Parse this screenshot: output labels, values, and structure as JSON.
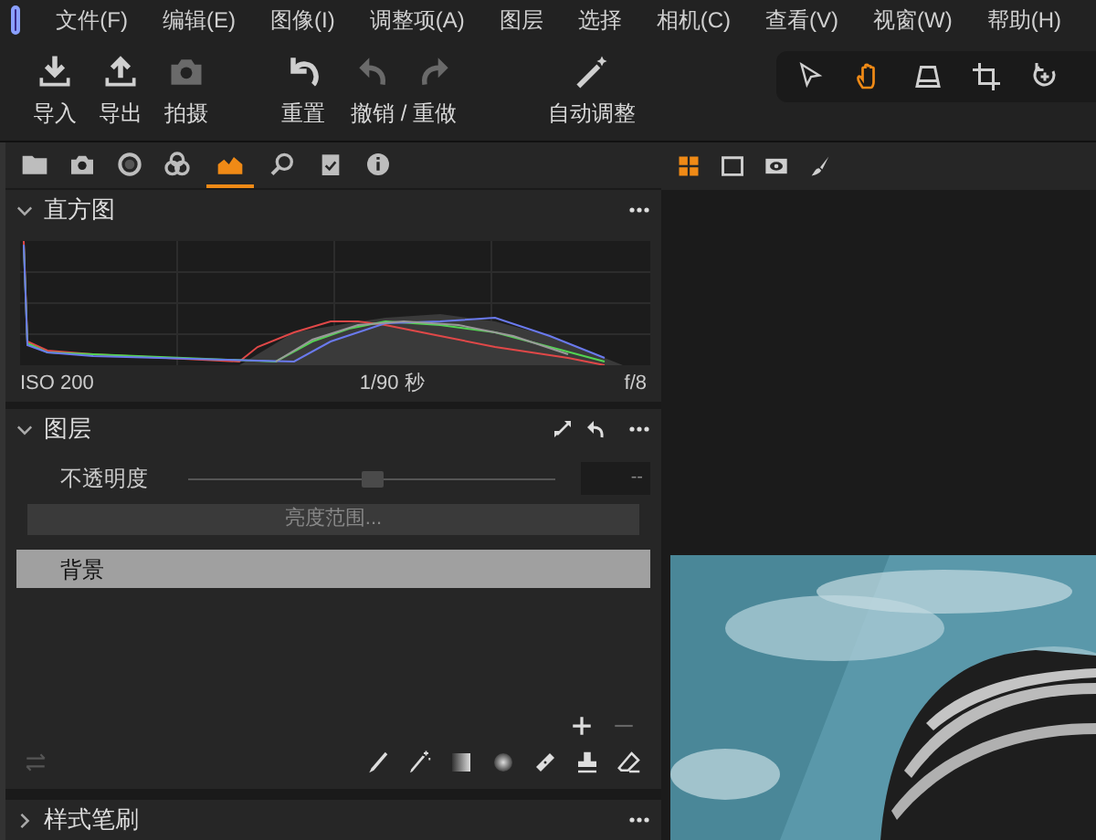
{
  "menu": [
    {
      "label": "文件(F)"
    },
    {
      "label": "编辑(E)"
    },
    {
      "label": "图像(I)"
    },
    {
      "label": "调整项(A)"
    },
    {
      "label": "图层"
    },
    {
      "label": "选择"
    },
    {
      "label": "相机(C)"
    },
    {
      "label": "查看(V)"
    },
    {
      "label": "视窗(W)"
    },
    {
      "label": "帮助(H)"
    }
  ],
  "toolbar": [
    {
      "label": "导入",
      "kind": "import",
      "disabled": false
    },
    {
      "label": "导出",
      "kind": "export",
      "disabled": false
    },
    {
      "label": "拍摄",
      "kind": "camera",
      "disabled": true
    },
    {
      "label": "重置",
      "kind": "reset",
      "disabled": false
    },
    {
      "label": "撤销 / 重做",
      "kind": "undoredo",
      "disabled": true
    },
    {
      "label": "自动调整",
      "kind": "wand",
      "disabled": false
    }
  ],
  "tools": [
    {
      "kind": "pointer",
      "selected": false
    },
    {
      "kind": "hand",
      "selected": true
    },
    {
      "kind": "keystone",
      "selected": false
    },
    {
      "kind": "crop",
      "selected": false
    },
    {
      "kind": "rotate",
      "selected": false
    }
  ],
  "panel_tabs": [
    {
      "kind": "folder",
      "selected": false
    },
    {
      "kind": "camera",
      "selected": false
    },
    {
      "kind": "circle",
      "selected": false
    },
    {
      "kind": "rings",
      "selected": false
    },
    {
      "kind": "histogram",
      "selected": true
    },
    {
      "kind": "search",
      "selected": false
    },
    {
      "kind": "clipboard",
      "selected": false
    },
    {
      "kind": "info",
      "selected": false
    }
  ],
  "histogram": {
    "title": "直方图",
    "expanded": true,
    "iso": "ISO 200",
    "shutter": "1/90 秒",
    "aperture": "f/8"
  },
  "layers": {
    "title": "图层",
    "expanded": true,
    "opacity_label": "不透明度",
    "opacity": {
      "level": 0.5,
      "value": "--"
    },
    "luminance_button": "亮度范围...",
    "items": [
      {
        "name": "背景",
        "selected": true
      }
    ]
  },
  "collapsed_sections": [
    {
      "title": "样式笔刷",
      "expanded": false
    }
  ],
  "viewer_tabs": [
    {
      "kind": "grid",
      "selected": true
    },
    {
      "kind": "single",
      "selected": false
    },
    {
      "kind": "eye",
      "selected": false
    },
    {
      "kind": "brush",
      "selected": false
    }
  ]
}
